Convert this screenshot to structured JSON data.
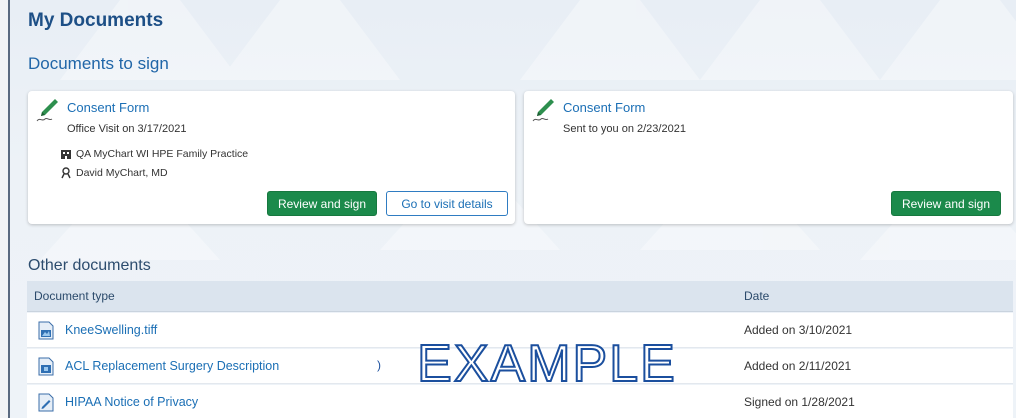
{
  "page": {
    "title": "My Documents"
  },
  "to_sign": {
    "title": "Documents to sign",
    "cards": [
      {
        "title": "Consent Form",
        "subtitle": "Office Visit on 3/17/2021",
        "department": "QA MyChart WI HPE Family Practice",
        "provider": "David MyChart, MD",
        "primary_button": "Review and sign",
        "secondary_button": "Go to visit details"
      },
      {
        "title": "Consent Form",
        "subtitle": "Sent to you on 2/23/2021",
        "primary_button": "Review and sign"
      }
    ]
  },
  "other": {
    "title": "Other documents",
    "columns": {
      "type": "Document type",
      "date": "Date"
    },
    "rows": [
      {
        "name": "KneeSwelling.tiff",
        "date": "Added on 3/10/2021",
        "icon": "image-file-icon"
      },
      {
        "name": "ACL Replacement Surgery Description",
        "extra": ")",
        "date": "Added on 2/11/2021",
        "icon": "medical-document-icon"
      },
      {
        "name": "HIPAA Notice of Privacy",
        "date": "Signed on 1/28/2021",
        "icon": "signed-document-icon"
      }
    ]
  },
  "watermark": {
    "text": "EXAMPLE"
  },
  "colors": {
    "accent": "#1b6fb5",
    "green_button": "#1b8a4b",
    "title": "#1d4f86",
    "table_header": "#dbe4ee"
  }
}
